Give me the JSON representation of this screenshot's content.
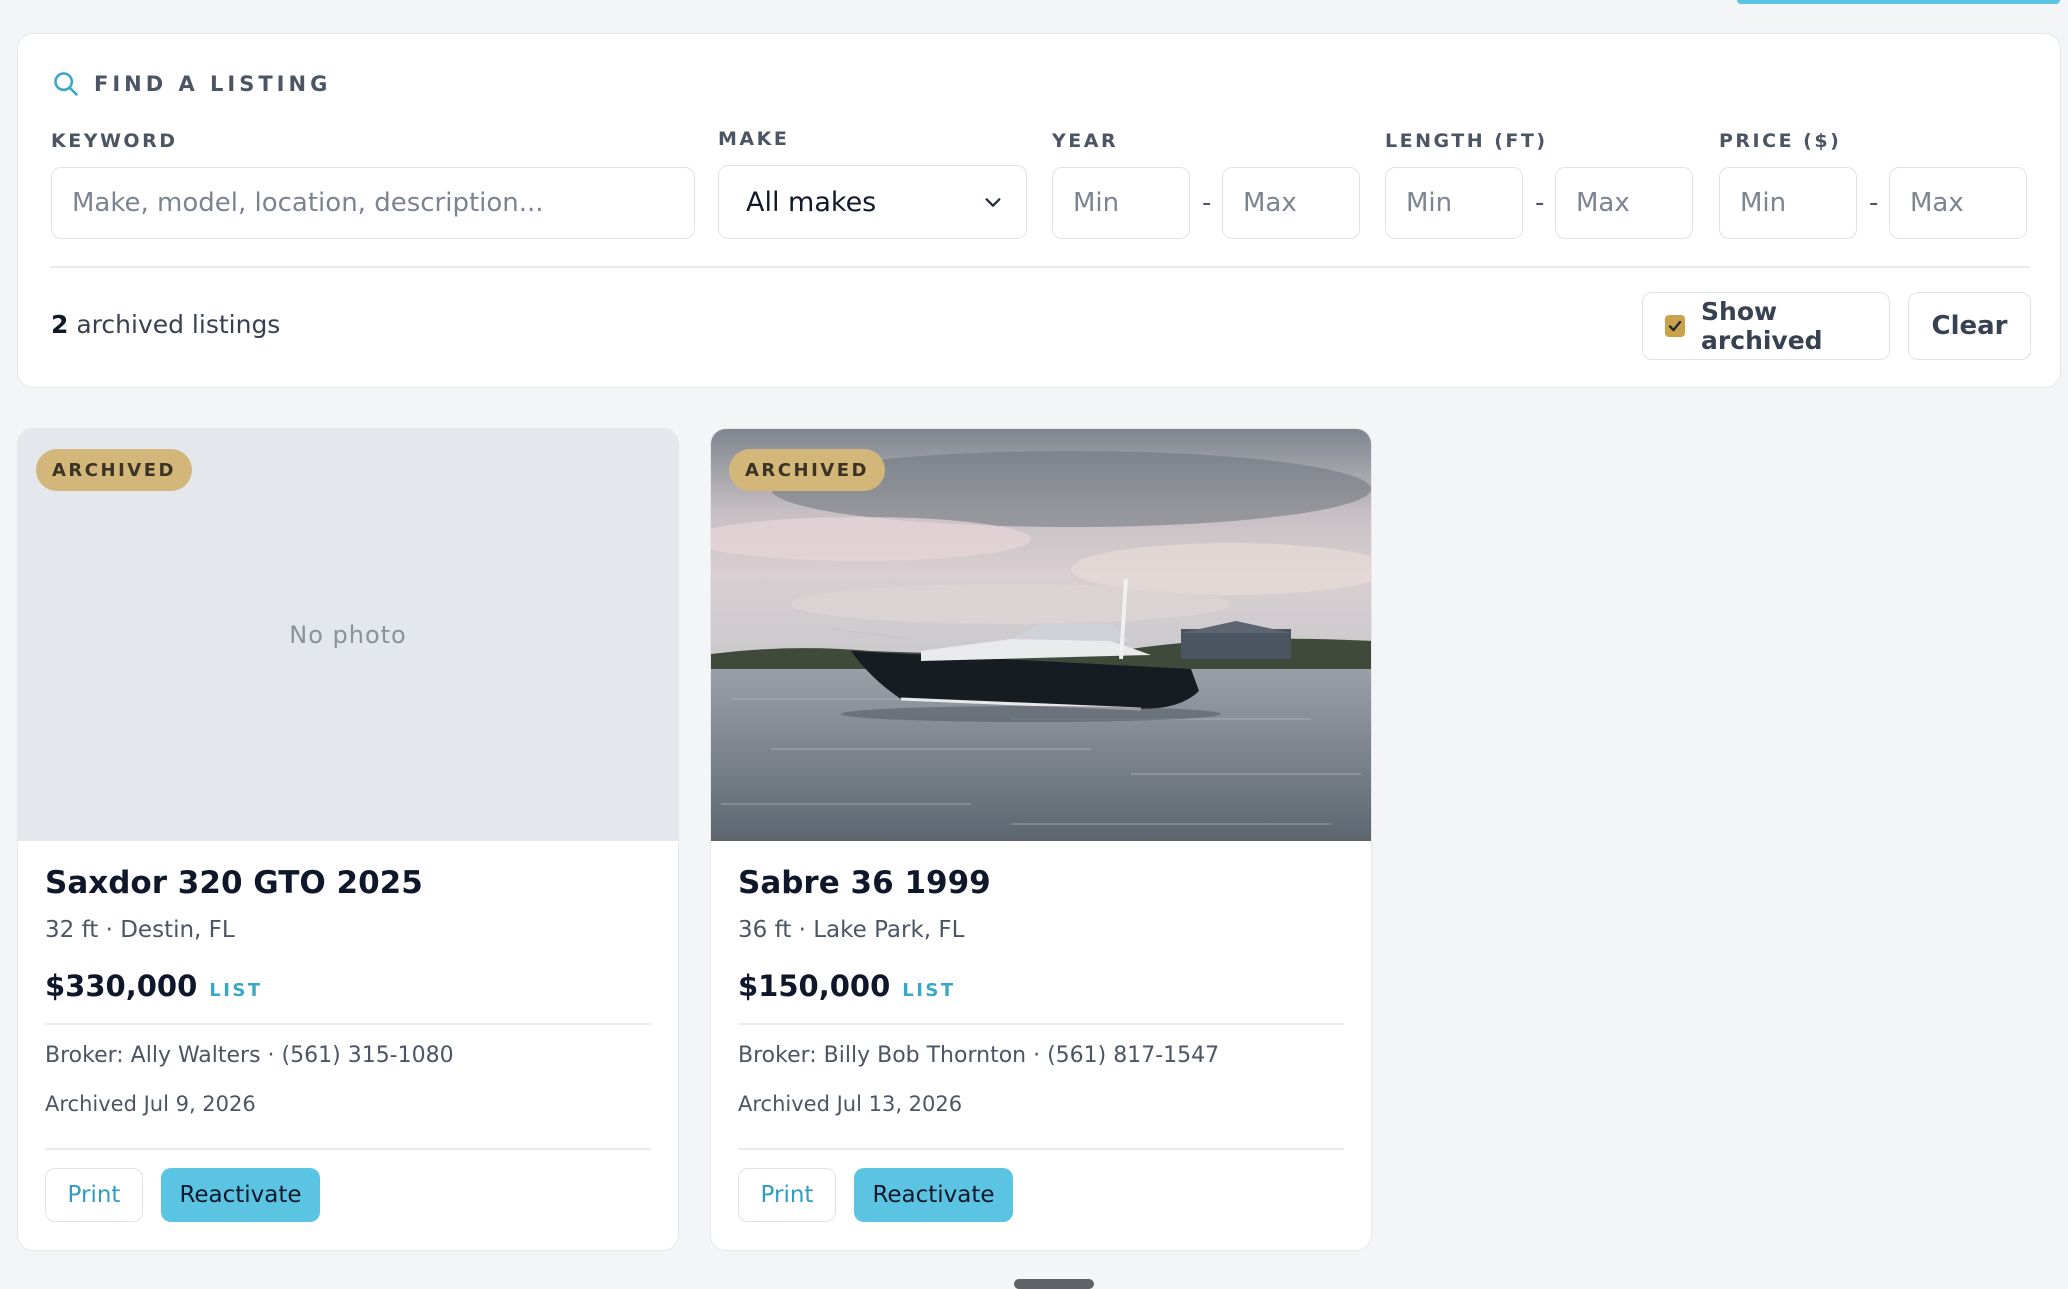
{
  "filter": {
    "title": "FIND A LISTING",
    "keyword": {
      "label": "KEYWORD",
      "placeholder": "Make, model, location, description..."
    },
    "make": {
      "label": "MAKE",
      "value": "All makes"
    },
    "year": {
      "label": "YEAR",
      "min_placeholder": "Min",
      "max_placeholder": "Max"
    },
    "length": {
      "label": "LENGTH (FT)",
      "min_placeholder": "Min",
      "max_placeholder": "Max"
    },
    "price": {
      "label": "PRICE ($)",
      "min_placeholder": "Min",
      "max_placeholder": "Max"
    },
    "range_separator": "-",
    "result_count": "2",
    "result_text": " archived listings",
    "show_archived_label": "Show archived",
    "show_archived_checked": true,
    "clear_label": "Clear"
  },
  "listings": [
    {
      "badge": "ARCHIVED",
      "photo": "No photo",
      "title": "Saxdor 320 GTO 2025",
      "subtitle": "32 ft · Destin, FL",
      "price": "$330,000",
      "price_tag": "LIST",
      "broker": "Broker: Ally Walters · (561) 315-1080",
      "archived": "Archived Jul 9, 2026",
      "print_label": "Print",
      "reactivate_label": "Reactivate"
    },
    {
      "badge": "ARCHIVED",
      "photo": null,
      "title": "Sabre 36 1999",
      "subtitle": "36 ft · Lake Park, FL",
      "price": "$150,000",
      "price_tag": "LIST",
      "broker": "Broker: Billy Bob Thornton · (561) 817-1547",
      "archived": "Archived Jul 13, 2026",
      "print_label": "Print",
      "reactivate_label": "Reactivate"
    }
  ],
  "colors": {
    "accent": "#5bc4e2",
    "badge": "#d2b67a",
    "checkbox": "#c9a24a",
    "link": "#2f9cc3"
  },
  "icons": {
    "search": "search-icon",
    "select_chevron": "chevron-down-icon",
    "check": "check-icon"
  }
}
